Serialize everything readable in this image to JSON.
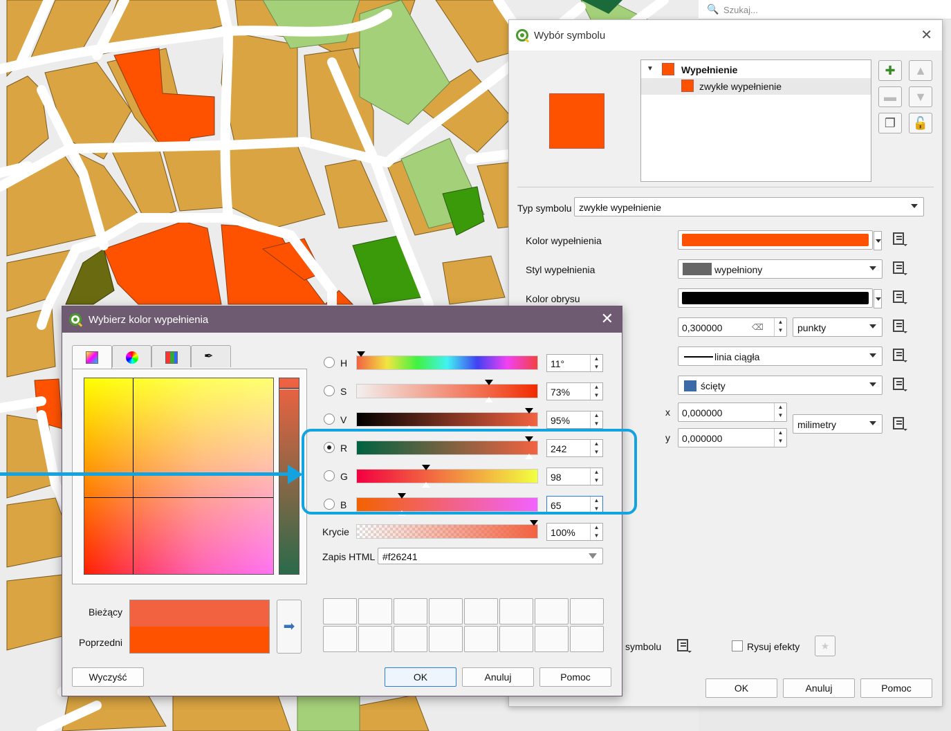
{
  "search": {
    "placeholder": "Szukaj..."
  },
  "symbol_dialog": {
    "title": "Wybór symbolu",
    "tree": {
      "root_label": "Wypełnienie",
      "child_label": "zwykłe wypełnienie"
    },
    "symbol_type_label": "Typ symbolu",
    "symbol_type_value": "zwykłe wypełnienie",
    "fill_color_label": "Kolor wypełnienia",
    "fill_color": "#fe5200",
    "fill_style_label": "Styl wypełnienia",
    "fill_style_value": "wypełniony",
    "stroke_color_label": "Kolor obrysu",
    "stroke_color": "#000000",
    "stroke_width_value": "0,300000",
    "stroke_width_unit": "punkty",
    "stroke_style_value": "linia ciągła",
    "join_style_value": "ścięty",
    "offset_x_label": "x",
    "offset_x_value": "0,000000",
    "offset_y_label": "y",
    "offset_y_value": "0,000000",
    "offset_unit": "milimetry",
    "symbol_partial_label": "symbolu",
    "draw_effects_label": "Rysuj efekty",
    "ok": "OK",
    "cancel": "Anuluj",
    "help": "Pomoc"
  },
  "color_dialog": {
    "title": "Wybierz kolor wypełnienia",
    "sliders": [
      {
        "key": "H",
        "value": "11°",
        "selected": false
      },
      {
        "key": "S",
        "value": "73%",
        "selected": false
      },
      {
        "key": "V",
        "value": "95%",
        "selected": false
      },
      {
        "key": "R",
        "value": "242",
        "selected": true
      },
      {
        "key": "G",
        "value": "98",
        "selected": false
      },
      {
        "key": "B",
        "value": "65",
        "selected": false
      }
    ],
    "opacity_label": "Krycie",
    "opacity_value": "100%",
    "html_label": "Zapis HTML",
    "html_value": "#f26241",
    "current_label": "Bieżący",
    "previous_label": "Poprzedni",
    "current_color": "#f26241",
    "previous_color": "#fe5200",
    "clear": "Wyczyść",
    "ok": "OK",
    "cancel": "Anuluj",
    "help": "Pomoc"
  },
  "colors": {
    "highlight": "#12a3e0",
    "map_parcel": "#d9a441",
    "map_red": "#fe5200",
    "map_green_light": "#a5d07a",
    "map_green": "#3a9a0a"
  }
}
